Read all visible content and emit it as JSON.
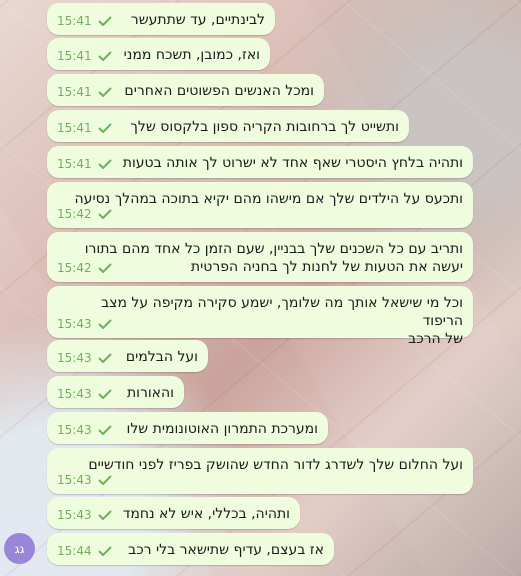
{
  "chat": {
    "messages": [
      {
        "text": "לבינתיים, עד שתתעשר",
        "time": "15:41"
      },
      {
        "text": "ואז, כמובן, תשכח ממני",
        "time": "15:41"
      },
      {
        "text": "ומכל האנשים הפשוטים האחרים",
        "time": "15:41"
      },
      {
        "text": "ותשייט לך ברחובות הקריה ספון בלקסוס שלך",
        "time": "15:41"
      },
      {
        "text": "ותהיה בלחץ היסטרי שאף אחד לא ישרוט לך אותה בטעות",
        "time": "15:41"
      },
      {
        "text": "ותכעס על הילדים שלך אם מישהו מהם יקיא בתוכה במהלך נסיעה",
        "time": "15:42"
      },
      {
        "text": "ותריב עם כל השכנים שלך בבניין, שעם הזמן כל אחד מהם בתורו\nיעשה את הטעות של לחנות לך בחניה הפרטית",
        "time": "15:42"
      },
      {
        "text": "וכל מי שישאל אותך מה שלומך, ישמע סקירה מקיפה על מצב הריפוד\nשל הרכב",
        "time": "15:43"
      },
      {
        "text": "ועל הבלמים",
        "time": "15:43"
      },
      {
        "text": "והאורות",
        "time": "15:43"
      },
      {
        "text": "ומערכת התמרון האוטונומית שלו",
        "time": "15:43"
      },
      {
        "text": "ועל החלום שלך לשדרג לדור החדש שהושק בפריז לפני חודשיים",
        "time": "15:43"
      },
      {
        "text": "ותהיה, בכללי, איש לא נחמד",
        "time": "15:43"
      },
      {
        "text": "אז בעצם, עדיף שתישאר בלי רכב",
        "time": "15:44"
      }
    ],
    "avatar_initials": "גג"
  },
  "colors": {
    "bubble": "#effdde",
    "time": "#6fb05b",
    "tick": "#6fb05b",
    "avatar": "#9a86d8"
  }
}
